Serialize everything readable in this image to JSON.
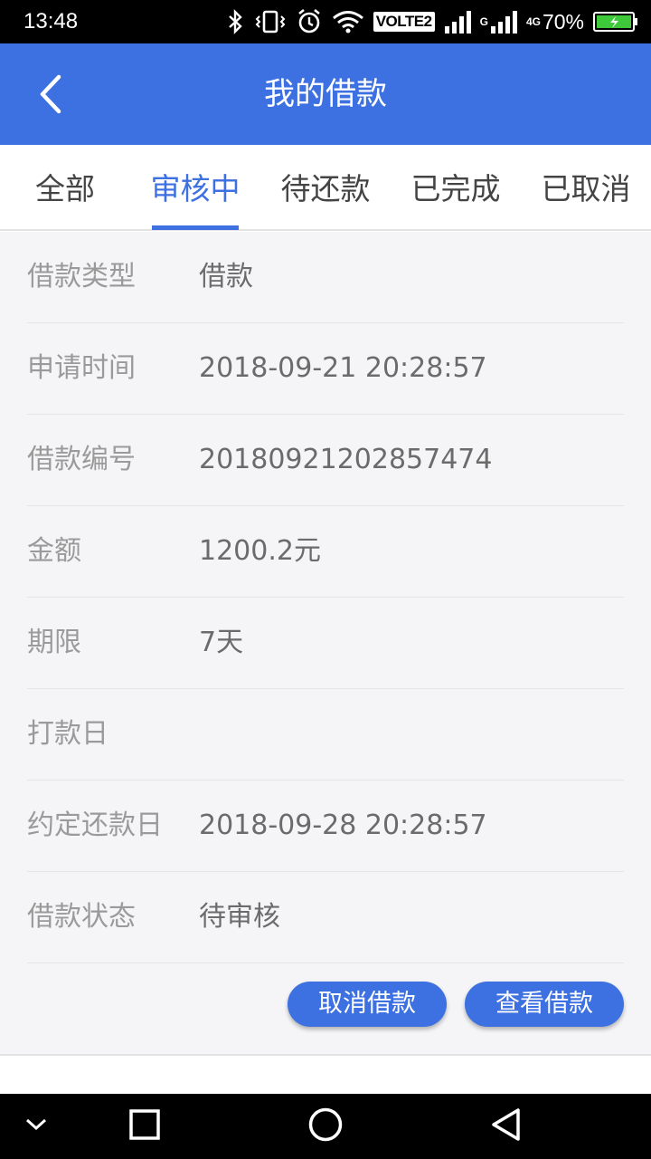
{
  "status_bar": {
    "time": "13:48",
    "volte": "VOLTE2",
    "network_1": "G",
    "network_2": "4G",
    "battery": "70%"
  },
  "app_bar": {
    "back_icon": "chevron-left-icon",
    "title": "我的借款",
    "color": "#3d70e0"
  },
  "tabs": [
    {
      "label": "全部",
      "active": false
    },
    {
      "label": "审核中",
      "active": true
    },
    {
      "label": "待还款",
      "active": false
    },
    {
      "label": "已完成",
      "active": false
    },
    {
      "label": "已取消",
      "active": false
    }
  ],
  "details": [
    {
      "label": "借款类型",
      "value": "借款"
    },
    {
      "label": "申请时间",
      "value": "2018-09-21 20:28:57"
    },
    {
      "label": "借款编号",
      "value": "20180921202857474"
    },
    {
      "label": "金额",
      "value": "1200.2元"
    },
    {
      "label": "期限",
      "value": "7天"
    },
    {
      "label": "打款日",
      "value": ""
    },
    {
      "label": "约定还款日",
      "value": "2018-09-28 20:28:57"
    },
    {
      "label": "借款状态",
      "value": "待审核"
    }
  ],
  "actions": {
    "cancel_label": "取消借款",
    "view_label": "查看借款"
  },
  "nav_bar": {
    "icons": [
      "chevron-down-icon",
      "square-recents-icon",
      "circle-home-icon",
      "triangle-back-icon"
    ]
  }
}
